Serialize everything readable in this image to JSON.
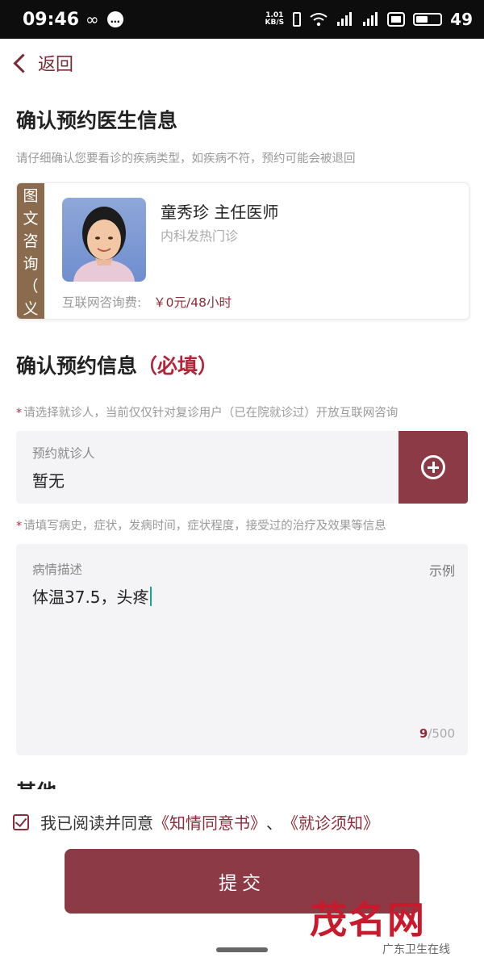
{
  "status_bar": {
    "time": "09:46",
    "glyph_infinity": "∞",
    "glyph_msg": "•••",
    "net_speed_value": "1.01",
    "net_speed_unit": "KB/S",
    "battery_level": "49"
  },
  "nav": {
    "back_label": "返回"
  },
  "doctor_section": {
    "title": "确认预约医生信息",
    "notice": "请仔细确认您要看诊的疾病类型，如疾病不符，预约可能会被退回"
  },
  "doctor_card": {
    "tag_chars": [
      "图",
      "文",
      "咨",
      "询",
      "（",
      "义"
    ],
    "name_title": "童秀珍 主任医师",
    "department": "内科发热门诊",
    "fee_label": "互联网咨询费:",
    "fee_value": "￥0元/48小时"
  },
  "booking_section": {
    "title": "确认预约信息",
    "required": "（必填）",
    "patient_hint": "请选择就诊人，当前仅仅针对复诊用户（已在院就诊过）开放互联网咨询",
    "history_hint": "请填写病史，症状，发病时间，症状程度，接受过的治疗及效果等信息"
  },
  "patient_field": {
    "label": "预约就诊人",
    "value": "暂无"
  },
  "description_field": {
    "label": "病情描述",
    "example_link": "示例",
    "value": "体温37.5，头疼",
    "count_current": "9",
    "count_max": "/500"
  },
  "other_section": {
    "title_partial": "其他"
  },
  "agreement": {
    "text": "我已阅读并同意",
    "link1": "《知情同意书》",
    "sep": "、",
    "link2": "《就诊须知》",
    "checked": true
  },
  "submit_label": "提交",
  "watermark": {
    "main": "茂名网",
    "sub": "广东卫生在线"
  },
  "colors": {
    "brand": "#8b3a46",
    "accent_red": "#b3263a",
    "tag_brown": "#8a6b4e"
  }
}
